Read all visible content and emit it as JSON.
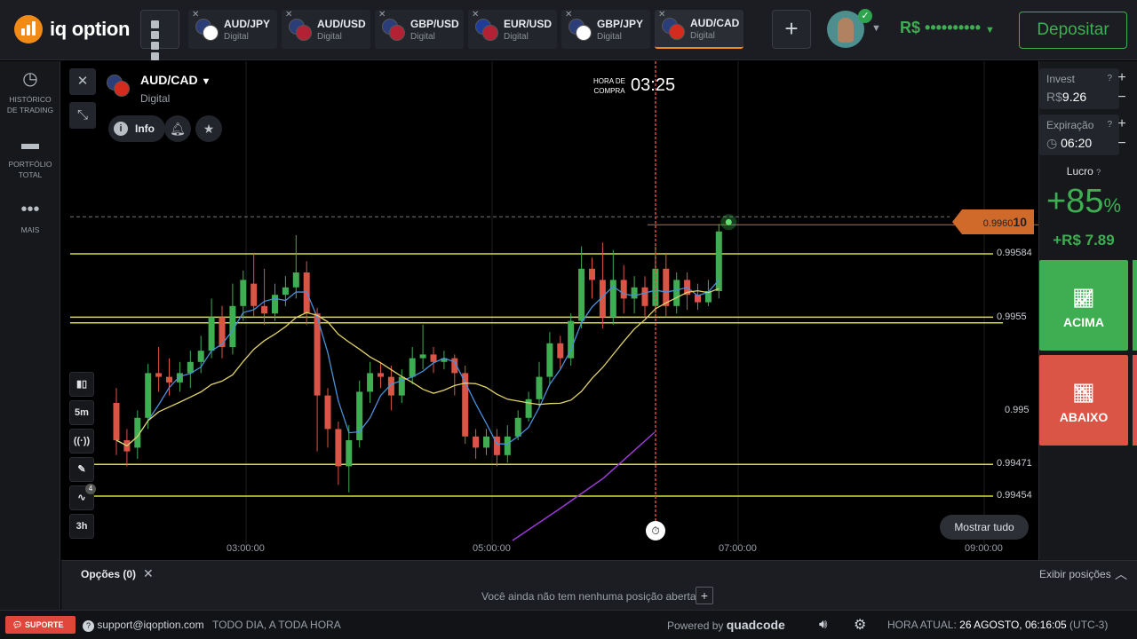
{
  "brand": {
    "name": "iq option"
  },
  "tabs": [
    {
      "pair": "AUD/JPY",
      "type": "Digital",
      "flag1": "#2b3e7a",
      "flag2": "#ffffff",
      "active": false
    },
    {
      "pair": "AUD/USD",
      "type": "Digital",
      "flag1": "#2b3e7a",
      "flag2": "#b22234",
      "active": false
    },
    {
      "pair": "GBP/USD",
      "type": "Digital",
      "flag1": "#2b3e7a",
      "flag2": "#b22234",
      "active": false
    },
    {
      "pair": "EUR/USD",
      "type": "Digital",
      "flag1": "#1f3c99",
      "flag2": "#b22234",
      "active": false
    },
    {
      "pair": "GBP/JPY",
      "type": "Digital",
      "flag1": "#2b3e7a",
      "flag2": "#ffffff",
      "active": false
    },
    {
      "pair": "AUD/CAD",
      "type": "Digital",
      "flag1": "#2b3e7a",
      "flag2": "#d52b1e",
      "active": true
    }
  ],
  "header": {
    "add_tab": "+",
    "balance": "R$ ••••••••••",
    "deposit": "Depositar"
  },
  "sidebar": {
    "items": [
      {
        "icon": "clock-icon",
        "label_line1": "HISTÓRICO",
        "label_line2": "DE TRADING"
      },
      {
        "icon": "briefcase-icon",
        "label_line1": "PORTFÓLIO",
        "label_line2": "TOTAL"
      },
      {
        "icon": "dots-icon",
        "label_line1": "MAIS",
        "label_line2": ""
      }
    ]
  },
  "asset": {
    "name": "AUD/CAD",
    "type": "Digital",
    "info": "Info"
  },
  "buy_time": {
    "label_line1": "HORA DE",
    "label_line2": "COMPRA",
    "value": "03:25"
  },
  "tools": {
    "chart_type": "candles-icon",
    "timeframe": "5m",
    "signals": "signals-icon",
    "draw": "pencil-icon",
    "indicators": "indicators-icon",
    "indicators_count": "4",
    "period": "3h"
  },
  "chart": {
    "current_price_prefix": "0.9960",
    "current_price_suffix": "10",
    "level_labels": [
      "0.99584",
      "0.9955",
      "0.995",
      "0.99471",
      "0.99454"
    ],
    "time_labels": [
      "03:00:00",
      "05:00:00",
      "07:00:00",
      "09:00:00"
    ],
    "show_all": "Mostrar tudo"
  },
  "chart_data": {
    "type": "candlestick",
    "instrument": "AUD/CAD",
    "interval": "5m",
    "price_ylim": [
      0.9943,
      0.9962
    ],
    "x_ticks": [
      "03:00:00",
      "05:00:00",
      "07:00:00",
      "09:00:00"
    ],
    "horizontal_levels": [
      0.99584,
      0.9955,
      0.99547,
      0.99471,
      0.99454
    ],
    "current_price": 0.99601,
    "candles": [
      {
        "o": 0.99504,
        "c": 0.99484,
        "h": 0.99512,
        "l": 0.99476
      },
      {
        "o": 0.99484,
        "c": 0.99478,
        "h": 0.9949,
        "l": 0.9947
      },
      {
        "o": 0.9948,
        "c": 0.99496,
        "h": 0.995,
        "l": 0.99474
      },
      {
        "o": 0.99496,
        "c": 0.9952,
        "h": 0.99525,
        "l": 0.9949
      },
      {
        "o": 0.9952,
        "c": 0.99518,
        "h": 0.99534,
        "l": 0.9951
      },
      {
        "o": 0.99518,
        "c": 0.99515,
        "h": 0.99528,
        "l": 0.99508
      },
      {
        "o": 0.99515,
        "c": 0.9952,
        "h": 0.99526,
        "l": 0.9951
      },
      {
        "o": 0.9952,
        "c": 0.99526,
        "h": 0.99532,
        "l": 0.99512
      },
      {
        "o": 0.99526,
        "c": 0.99532,
        "h": 0.9954,
        "l": 0.9952
      },
      {
        "o": 0.99532,
        "c": 0.9955,
        "h": 0.9956,
        "l": 0.99528
      },
      {
        "o": 0.9955,
        "c": 0.99534,
        "h": 0.99556,
        "l": 0.99528
      },
      {
        "o": 0.99534,
        "c": 0.99556,
        "h": 0.99568,
        "l": 0.9953
      },
      {
        "o": 0.99556,
        "c": 0.9957,
        "h": 0.99575,
        "l": 0.99548
      },
      {
        "o": 0.99568,
        "c": 0.99556,
        "h": 0.99584,
        "l": 0.9955
      },
      {
        "o": 0.99556,
        "c": 0.99552,
        "h": 0.99576,
        "l": 0.99546
      },
      {
        "o": 0.99552,
        "c": 0.99562,
        "h": 0.99568,
        "l": 0.99548
      },
      {
        "o": 0.99562,
        "c": 0.99566,
        "h": 0.99572,
        "l": 0.99556
      },
      {
        "o": 0.99566,
        "c": 0.99574,
        "h": 0.99594,
        "l": 0.9956
      },
      {
        "o": 0.99574,
        "c": 0.99552,
        "h": 0.9958,
        "l": 0.99546
      },
      {
        "o": 0.99552,
        "c": 0.99508,
        "h": 0.99555,
        "l": 0.99478
      },
      {
        "o": 0.99508,
        "c": 0.9949,
        "h": 0.99512,
        "l": 0.9948
      },
      {
        "o": 0.9949,
        "c": 0.9947,
        "h": 0.99494,
        "l": 0.9946
      },
      {
        "o": 0.9947,
        "c": 0.99484,
        "h": 0.99492,
        "l": 0.99456
      },
      {
        "o": 0.99484,
        "c": 0.9951,
        "h": 0.99516,
        "l": 0.9948
      },
      {
        "o": 0.9951,
        "c": 0.9952,
        "h": 0.99526,
        "l": 0.99504
      },
      {
        "o": 0.9952,
        "c": 0.99518,
        "h": 0.99526,
        "l": 0.99512
      },
      {
        "o": 0.99518,
        "c": 0.99508,
        "h": 0.99524,
        "l": 0.995
      },
      {
        "o": 0.99508,
        "c": 0.99518,
        "h": 0.99522,
        "l": 0.99504
      },
      {
        "o": 0.99518,
        "c": 0.99528,
        "h": 0.99534,
        "l": 0.99514
      },
      {
        "o": 0.99528,
        "c": 0.9953,
        "h": 0.99546,
        "l": 0.99522
      },
      {
        "o": 0.9953,
        "c": 0.99526,
        "h": 0.99534,
        "l": 0.9952
      },
      {
        "o": 0.99526,
        "c": 0.99528,
        "h": 0.99532,
        "l": 0.99522
      },
      {
        "o": 0.99528,
        "c": 0.9952,
        "h": 0.9953,
        "l": 0.99508
      },
      {
        "o": 0.9952,
        "c": 0.99486,
        "h": 0.99524,
        "l": 0.99482
      },
      {
        "o": 0.99486,
        "c": 0.9948,
        "h": 0.9949,
        "l": 0.99474
      },
      {
        "o": 0.9948,
        "c": 0.99486,
        "h": 0.9949,
        "l": 0.99476
      },
      {
        "o": 0.99486,
        "c": 0.99476,
        "h": 0.9949,
        "l": 0.9947
      },
      {
        "o": 0.99476,
        "c": 0.99486,
        "h": 0.99492,
        "l": 0.99472
      },
      {
        "o": 0.99486,
        "c": 0.99496,
        "h": 0.995,
        "l": 0.99484
      },
      {
        "o": 0.99496,
        "c": 0.99506,
        "h": 0.9951,
        "l": 0.99494
      },
      {
        "o": 0.99506,
        "c": 0.99518,
        "h": 0.99526,
        "l": 0.99502
      },
      {
        "o": 0.99518,
        "c": 0.99536,
        "h": 0.99542,
        "l": 0.99514
      },
      {
        "o": 0.99536,
        "c": 0.99528,
        "h": 0.9954,
        "l": 0.99522
      },
      {
        "o": 0.99528,
        "c": 0.99548,
        "h": 0.99552,
        "l": 0.99524
      },
      {
        "o": 0.99548,
        "c": 0.99576,
        "h": 0.99588,
        "l": 0.99544
      },
      {
        "o": 0.99576,
        "c": 0.9957,
        "h": 0.99582,
        "l": 0.9956
      },
      {
        "o": 0.9957,
        "c": 0.9955,
        "h": 0.9959,
        "l": 0.99544
      },
      {
        "o": 0.9955,
        "c": 0.9957,
        "h": 0.99586,
        "l": 0.99546
      },
      {
        "o": 0.9957,
        "c": 0.9956,
        "h": 0.99578,
        "l": 0.99552
      },
      {
        "o": 0.9956,
        "c": 0.99566,
        "h": 0.99572,
        "l": 0.99552
      },
      {
        "o": 0.99566,
        "c": 0.99556,
        "h": 0.99572,
        "l": 0.9955
      },
      {
        "o": 0.99556,
        "c": 0.99576,
        "h": 0.99588,
        "l": 0.99552
      },
      {
        "o": 0.99576,
        "c": 0.99556,
        "h": 0.99584,
        "l": 0.9955
      },
      {
        "o": 0.99556,
        "c": 0.9957,
        "h": 0.99574,
        "l": 0.99552
      },
      {
        "o": 0.9957,
        "c": 0.99562,
        "h": 0.99574,
        "l": 0.99554
      },
      {
        "o": 0.99562,
        "c": 0.99558,
        "h": 0.99568,
        "l": 0.99554
      },
      {
        "o": 0.99558,
        "c": 0.99564,
        "h": 0.9957,
        "l": 0.99556
      },
      {
        "o": 0.99564,
        "c": 0.99596,
        "h": 0.996,
        "l": 0.9956
      }
    ]
  },
  "panel": {
    "invest_label": "Invest",
    "invest_currency": "R$",
    "invest_value": "9.26",
    "expiry_label": "Expiração",
    "expiry_value": "06:20",
    "profit_label": "Lucro",
    "profit_pct": "+85",
    "profit_pct_unit": "%",
    "profit_amount": "+R$ 7.89",
    "up_label": "ACIMA",
    "down_label": "ABAIXO",
    "colors": {
      "up": "#3fae52",
      "down": "#db5546",
      "accent": "#f28a16"
    }
  },
  "options": {
    "title": "Opções (0)",
    "show_positions": "Exibir posições",
    "empty": "Você ainda não tem nenhuma posição aberta"
  },
  "footer": {
    "support": "SUPORTE",
    "email": "support@iqoption.com",
    "hours": "TODO DIA, A TODA HORA",
    "powered": "Powered by",
    "powered_brand": "quadcode",
    "time_label": "HORA ATUAL:",
    "time_value": "26 AGOSTO, 06:16:05",
    "tz": "(UTC-3)"
  }
}
